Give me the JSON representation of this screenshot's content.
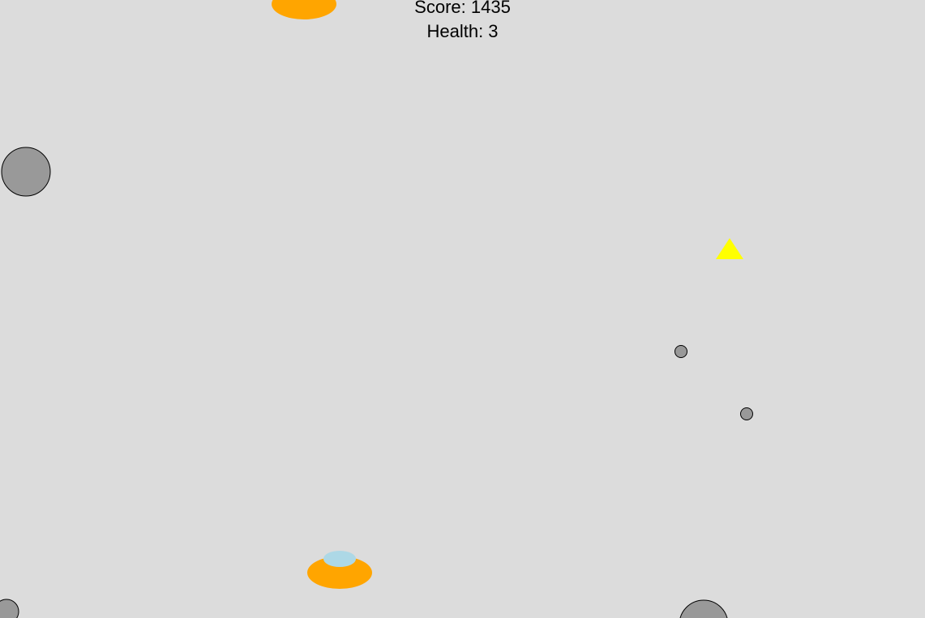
{
  "hud": {
    "score_text": "Score: 1435",
    "health_text": "Health: 3"
  },
  "colors": {
    "background": "#dcdcdc",
    "asteroid_fill": "#999999",
    "asteroid_stroke": "#000000",
    "saucer_body": "#ffa500",
    "saucer_dome": "#add8e6",
    "player_ship": "#ffff00"
  }
}
